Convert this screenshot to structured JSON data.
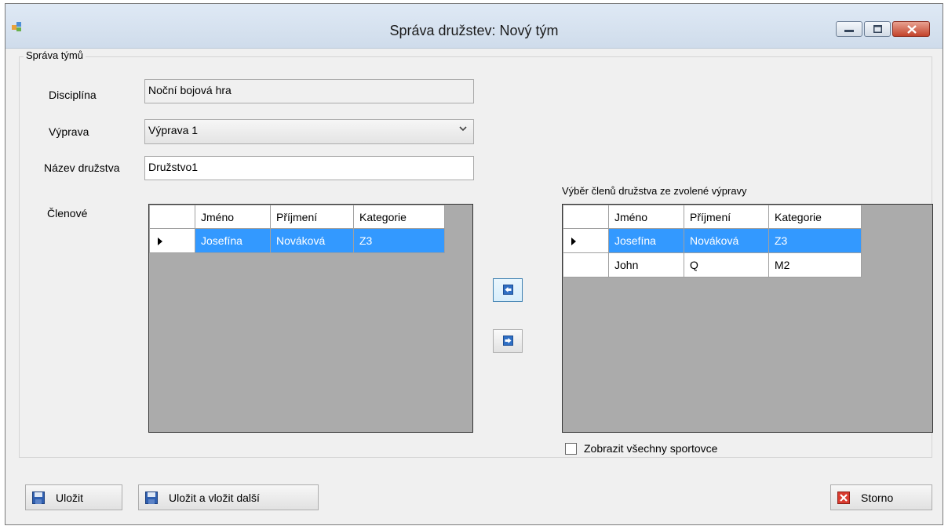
{
  "window": {
    "title": "Správa družstev: Nový tým",
    "icon": "app-icon",
    "controls": [
      "minimize-icon",
      "maximize-icon",
      "close-icon"
    ]
  },
  "group": {
    "label": "Správa týmů",
    "discipline": {
      "label": "Disciplína",
      "value": "Noční bojová hra"
    },
    "expedition": {
      "label": "Výprava",
      "value": "Výprava 1"
    },
    "team_name": {
      "label": "Název družstva",
      "value": "Družstvo1"
    },
    "members": {
      "label": "Členové",
      "columns": [
        "Jméno",
        "Příjmení",
        "Kategorie"
      ],
      "rows": [
        [
          "Josefína",
          "Nováková",
          "Z3"
        ]
      ]
    },
    "selection": {
      "label": "Výběr členů družstva ze zvolené výpravy",
      "columns": [
        "Jméno",
        "Příjmení",
        "Kategorie"
      ],
      "rows": [
        [
          "Josefína",
          "Nováková",
          "Z3"
        ],
        [
          "John",
          "Q",
          "M2"
        ]
      ]
    },
    "show_all": {
      "label": "Zobrazit všechny sportovce",
      "checked": false
    }
  },
  "buttons": {
    "save": "Uložit",
    "save_next": "Uložit a vložit další",
    "cancel": "Storno"
  },
  "colors": {
    "selection": "#3399ff",
    "grid_bg": "#ababab",
    "window_bg": "#f0f0f0"
  }
}
